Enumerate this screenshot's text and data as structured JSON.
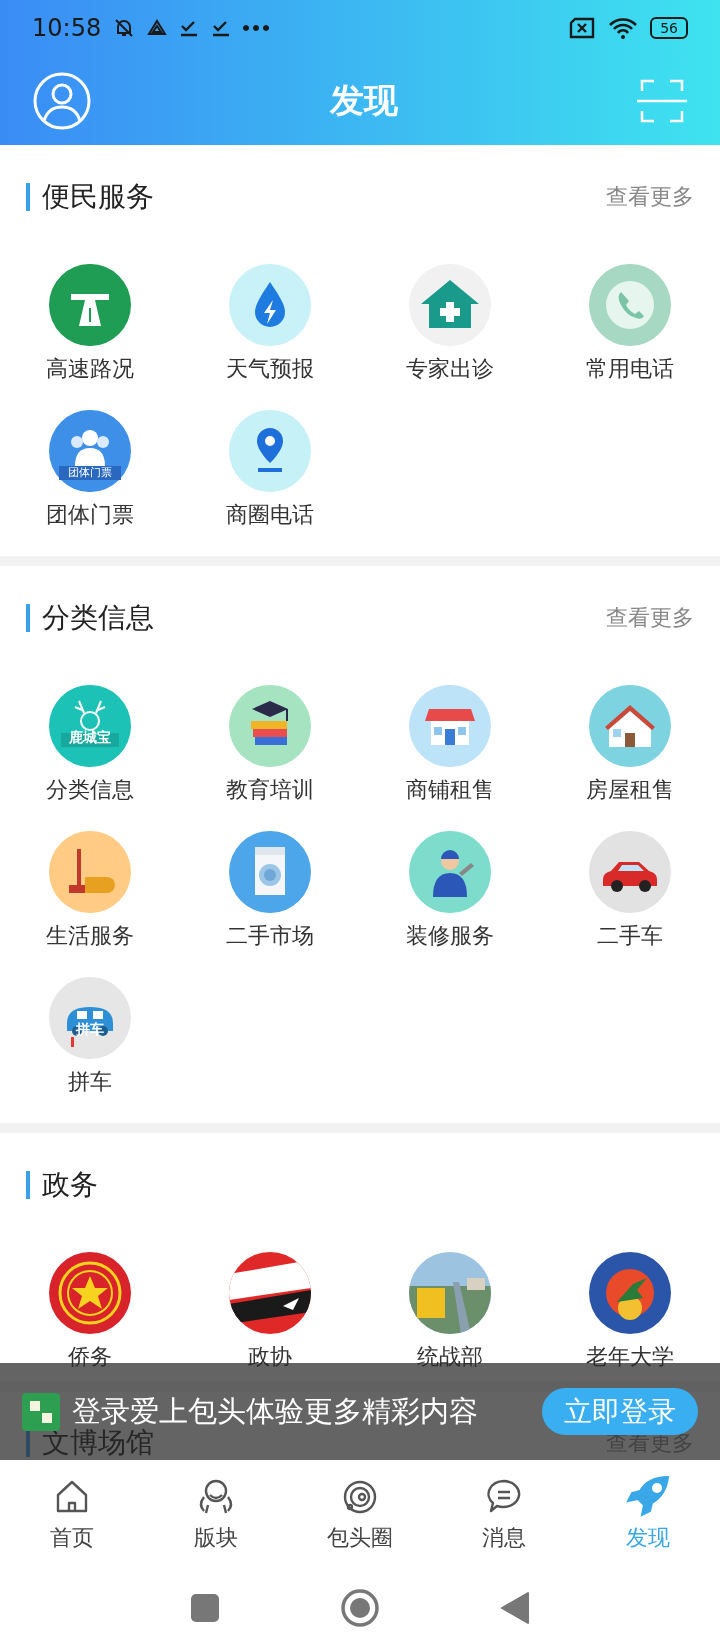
{
  "status_bar": {
    "time": "10:58",
    "battery": "56"
  },
  "header": {
    "title": "发现"
  },
  "sections": [
    {
      "title": "便民服务",
      "more": "查看更多",
      "items": [
        {
          "label": "高速路况",
          "kind": "icon"
        },
        {
          "label": "天气预报",
          "kind": "icon"
        },
        {
          "label": "专家出诊",
          "kind": "icon"
        },
        {
          "label": "常用电话",
          "kind": "icon"
        },
        {
          "label": "团体门票",
          "kind": "icon",
          "caption": "团体门票"
        },
        {
          "label": "商圈电话",
          "kind": "icon"
        }
      ]
    },
    {
      "title": "分类信息",
      "more": "查看更多",
      "items": [
        {
          "label": "分类信息",
          "kind": "icon",
          "caption": "鹿城宝"
        },
        {
          "label": "教育培训",
          "kind": "icon"
        },
        {
          "label": "商铺租售",
          "kind": "icon"
        },
        {
          "label": "房屋租售",
          "kind": "icon"
        },
        {
          "label": "生活服务",
          "kind": "icon"
        },
        {
          "label": "二手市场",
          "kind": "icon"
        },
        {
          "label": "装修服务",
          "kind": "icon"
        },
        {
          "label": "二手车",
          "kind": "icon"
        },
        {
          "label": "拼车",
          "kind": "icon",
          "caption": "拼车"
        }
      ]
    },
    {
      "title": "政务",
      "items": [
        {
          "label": "侨务",
          "kind": "picture"
        },
        {
          "label": "政协",
          "kind": "picture"
        },
        {
          "label": "统战部",
          "kind": "picture"
        },
        {
          "label": "老年大学",
          "kind": "picture"
        }
      ]
    },
    {
      "title": "文博场馆",
      "more": "查看更多"
    }
  ],
  "login_banner": {
    "text": "登录爱上包头体验更多精彩内容",
    "button": "立即登录"
  },
  "bottom_nav": [
    {
      "label": "首页",
      "selected": false
    },
    {
      "label": "版块",
      "selected": false
    },
    {
      "label": "包头圈",
      "selected": false
    },
    {
      "label": "消息",
      "selected": false
    },
    {
      "label": "发现",
      "selected": true
    }
  ]
}
